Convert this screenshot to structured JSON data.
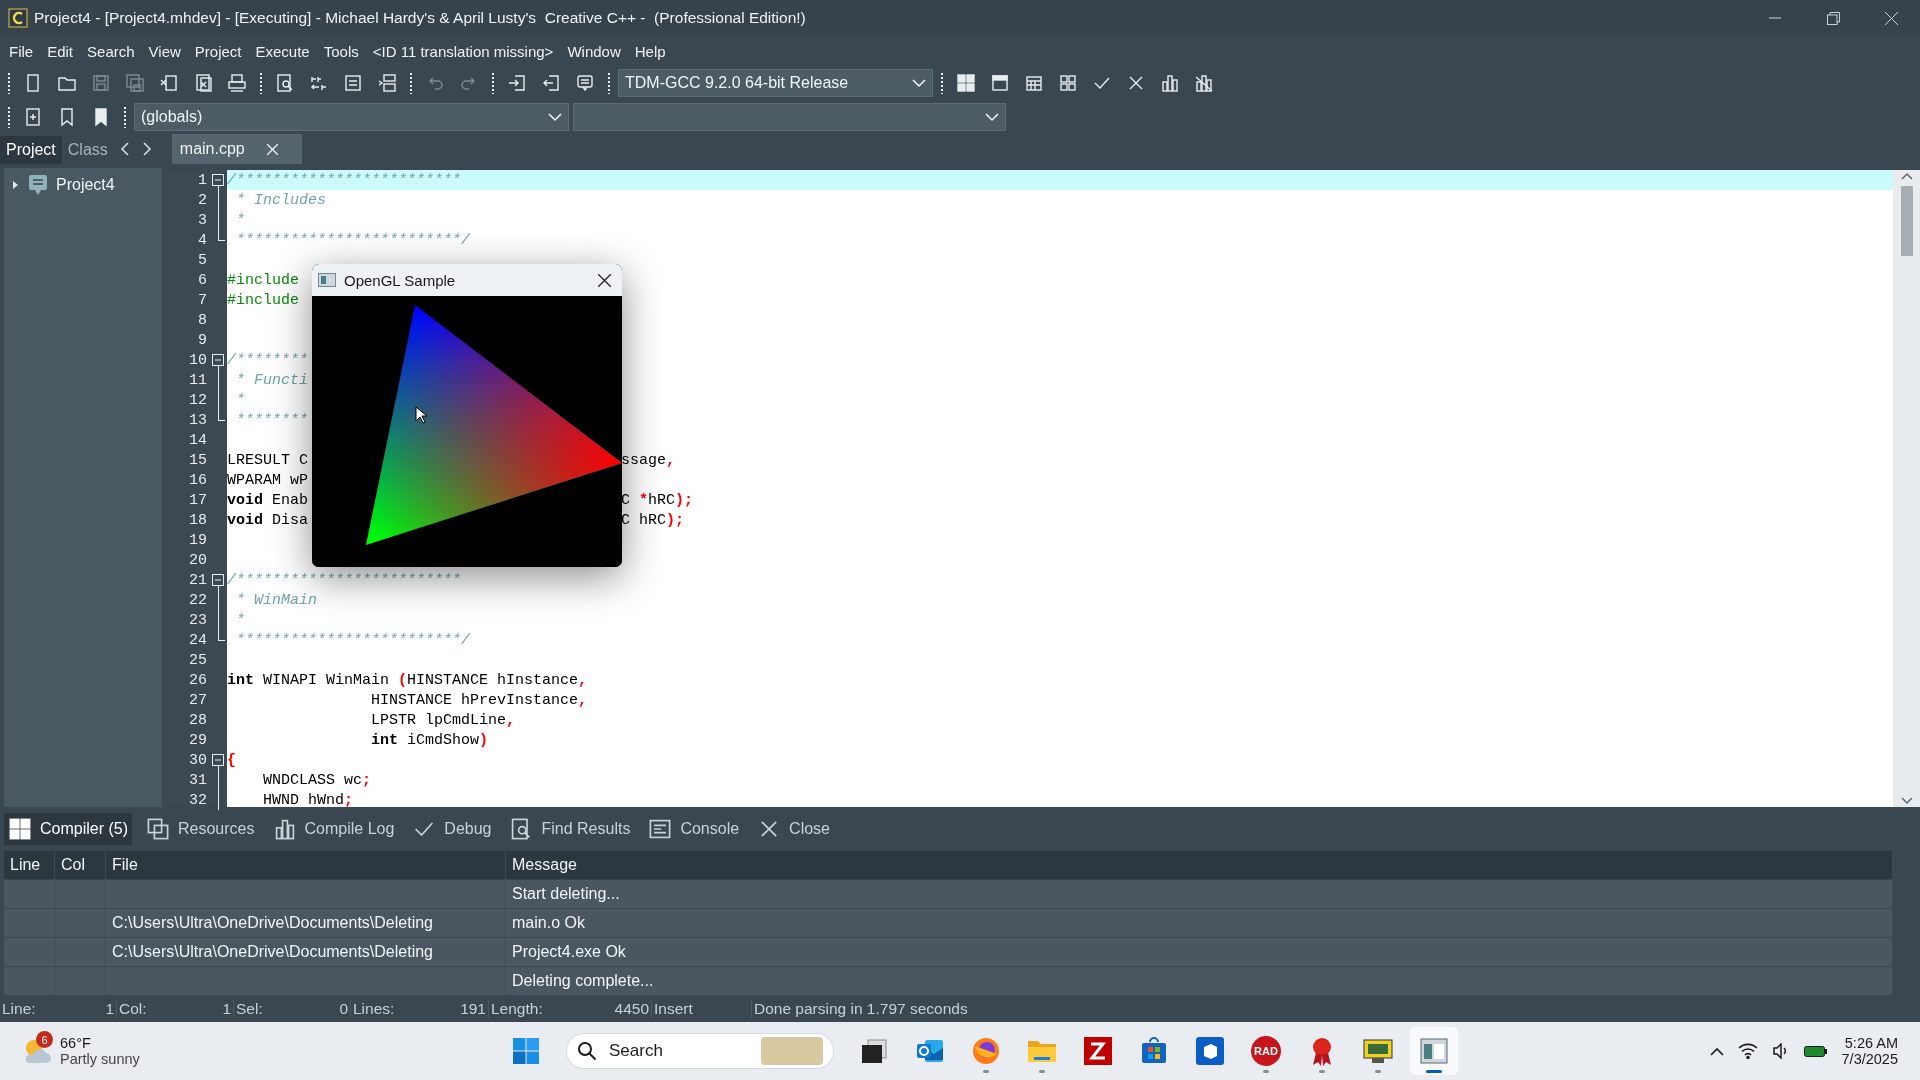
{
  "title_bar": {
    "title": "Project4 - [Project4.mhdev] - [Executing] - Michael Hardy's & April Lusty's  Creative C++ -  (Professional Edition!)"
  },
  "menu": [
    "File",
    "Edit",
    "Search",
    "View",
    "Project",
    "Execute",
    "Tools",
    "<ID 11 translation missing>",
    "Window",
    "Help"
  ],
  "toolbar_1": [
    {
      "kind": "grip",
      "disabled": false
    },
    {
      "kind": "page",
      "disabled": false
    },
    {
      "kind": "folder",
      "disabled": false
    },
    {
      "kind": "floppy",
      "disabled": true
    },
    {
      "kind": "floppies",
      "disabled": true
    },
    {
      "kind": "page-x",
      "disabled": false
    },
    {
      "kind": "pages-x",
      "disabled": false
    },
    {
      "kind": "printer",
      "disabled": false
    },
    {
      "kind": "grip",
      "disabled": false
    },
    {
      "kind": "page-magnifier",
      "disabled": false
    },
    {
      "kind": "spellcheck",
      "disabled": false
    },
    {
      "kind": "indent-box",
      "disabled": false
    },
    {
      "kind": "split-panel",
      "disabled": false
    },
    {
      "kind": "grip",
      "disabled": false
    },
    {
      "kind": "undo",
      "disabled": true
    },
    {
      "kind": "redo",
      "disabled": true
    },
    {
      "kind": "grip",
      "disabled": false
    },
    {
      "kind": "page-arrow-in",
      "disabled": false
    },
    {
      "kind": "page-arrow-out",
      "disabled": false
    },
    {
      "kind": "comment",
      "disabled": false
    },
    {
      "kind": "grip",
      "disabled": false
    },
    {
      "kind": "dropdown",
      "value": "TDM-GCC 9.2.0 64-bit Release",
      "disabled": false
    },
    {
      "kind": "grip",
      "disabled": false
    },
    {
      "kind": "grid",
      "disabled": false
    },
    {
      "kind": "window",
      "disabled": false
    },
    {
      "kind": "calendar",
      "disabled": false
    },
    {
      "kind": "tiles",
      "disabled": false
    },
    {
      "kind": "check",
      "disabled": false
    },
    {
      "kind": "cross",
      "disabled": false
    },
    {
      "kind": "chart",
      "disabled": false
    },
    {
      "kind": "chart-x",
      "disabled": false
    }
  ],
  "toolbar_2": [
    {
      "kind": "grip",
      "disabled": false
    },
    {
      "kind": "page-plus",
      "disabled": false
    },
    {
      "kind": "bookmark",
      "disabled": false
    },
    {
      "kind": "bookmark-filled",
      "disabled": false
    },
    {
      "kind": "grip",
      "disabled": false
    },
    {
      "kind": "dropdown",
      "value": "(globals)",
      "disabled": false
    },
    {
      "kind": "dropdown",
      "disabled": false
    }
  ],
  "side_tabs": [
    {
      "label": "Project",
      "selected": true
    },
    {
      "label": "Class",
      "selected": false
    }
  ],
  "editor_tabs": [
    {
      "label": "main.cpp",
      "selected": true
    }
  ],
  "tree": [
    {
      "label": "Project4",
      "expanded": false
    }
  ],
  "code": [
    {
      "number": "1",
      "kind": "fold-start",
      "current": true,
      "left": [
        {
          "kind": "comment",
          "text": "/*************************"
        }
      ]
    },
    {
      "number": "2",
      "kind": "fold-body",
      "current": false,
      "left": [
        {
          "kind": "comment",
          "text": " * Includes"
        }
      ]
    },
    {
      "number": "3",
      "kind": "fold-body",
      "current": false,
      "left": [
        {
          "kind": "comment",
          "text": " *"
        }
      ]
    },
    {
      "number": "4",
      "kind": "fold-end",
      "current": false,
      "left": [
        {
          "kind": "comment",
          "text": " *************************/"
        }
      ]
    },
    {
      "number": "5",
      "kind": "plain",
      "current": false
    },
    {
      "number": "6",
      "kind": "plain",
      "current": false,
      "left": [
        {
          "kind": "preproc",
          "text": "#include"
        }
      ]
    },
    {
      "number": "7",
      "kind": "plain",
      "current": false,
      "left": [
        {
          "kind": "preproc",
          "text": "#include"
        }
      ]
    },
    {
      "number": "8",
      "kind": "plain",
      "current": false
    },
    {
      "number": "9",
      "kind": "plain",
      "current": false
    },
    {
      "number": "10",
      "kind": "fold-start",
      "current": false,
      "left": [
        {
          "kind": "comment",
          "text": "/********"
        }
      ]
    },
    {
      "number": "11",
      "kind": "fold-body",
      "current": false,
      "left": [
        {
          "kind": "comment",
          "text": " * Functi"
        }
      ]
    },
    {
      "number": "12",
      "kind": "fold-body",
      "current": false,
      "left": [
        {
          "kind": "comment",
          "text": " *"
        }
      ]
    },
    {
      "number": "13",
      "kind": "fold-end",
      "current": false,
      "left": [
        {
          "kind": "comment",
          "text": " ********"
        }
      ]
    },
    {
      "number": "14",
      "kind": "plain",
      "current": false
    },
    {
      "number": "15",
      "kind": "plain",
      "current": false,
      "left": [
        {
          "kind": "plain",
          "text": "LRESULT C"
        }
      ],
      "right": [
        {
          "kind": "plain",
          "text": "ssage"
        },
        {
          "kind": "punct",
          "text": ","
        }
      ]
    },
    {
      "number": "16",
      "kind": "plain",
      "current": false,
      "left": [
        {
          "kind": "plain",
          "text": "WPARAM wP"
        }
      ]
    },
    {
      "number": "17",
      "kind": "plain",
      "current": false,
      "left": [
        {
          "kind": "keyword",
          "text": "void"
        },
        {
          "kind": "plain",
          "text": " Enab"
        }
      ],
      "right": [
        {
          "kind": "plain",
          "text": "C "
        },
        {
          "kind": "punct",
          "text": "*"
        },
        {
          "kind": "plain",
          "text": "hRC"
        },
        {
          "kind": "punct",
          "text": ");"
        }
      ]
    },
    {
      "number": "18",
      "kind": "plain",
      "current": false,
      "left": [
        {
          "kind": "keyword",
          "text": "void"
        },
        {
          "kind": "plain",
          "text": " Disa"
        }
      ],
      "right": [
        {
          "kind": "plain",
          "text": "C hRC"
        },
        {
          "kind": "punct",
          "text": ");"
        }
      ]
    },
    {
      "number": "19",
      "kind": "plain",
      "current": false
    },
    {
      "number": "20",
      "kind": "plain",
      "current": false
    },
    {
      "number": "21",
      "kind": "fold-start",
      "current": false,
      "left": [
        {
          "kind": "comment",
          "text": "/*************************"
        }
      ]
    },
    {
      "number": "22",
      "kind": "fold-body",
      "current": false,
      "left": [
        {
          "kind": "comment",
          "text": " * WinMain"
        }
      ]
    },
    {
      "number": "23",
      "kind": "fold-body",
      "current": false,
      "left": [
        {
          "kind": "comment",
          "text": " *"
        }
      ]
    },
    {
      "number": "24",
      "kind": "fold-end",
      "current": false,
      "left": [
        {
          "kind": "comment",
          "text": " *************************/"
        }
      ]
    },
    {
      "number": "25",
      "kind": "plain",
      "current": false
    },
    {
      "number": "26",
      "kind": "plain",
      "current": false,
      "left": [
        {
          "kind": "keyword",
          "text": "int"
        },
        {
          "kind": "plain",
          "text": " WINAPI WinMain "
        },
        {
          "kind": "punct",
          "text": "("
        },
        {
          "kind": "plain",
          "text": "HINSTANCE hInstance"
        },
        {
          "kind": "punct",
          "text": ","
        }
      ]
    },
    {
      "number": "27",
      "kind": "plain",
      "current": false,
      "left": [
        {
          "kind": "plain",
          "text": "                HINSTANCE hPrevInstance"
        },
        {
          "kind": "punct",
          "text": ","
        }
      ]
    },
    {
      "number": "28",
      "kind": "plain",
      "current": false,
      "left": [
        {
          "kind": "plain",
          "text": "                LPSTR lpCmdLine"
        },
        {
          "kind": "punct",
          "text": ","
        }
      ]
    },
    {
      "number": "29",
      "kind": "plain",
      "current": false,
      "left": [
        {
          "kind": "keyword",
          "text": "                int"
        },
        {
          "kind": "plain",
          "text": " iCmdShow"
        },
        {
          "kind": "punct",
          "text": ")"
        }
      ]
    },
    {
      "number": "30",
      "kind": "fold-start",
      "current": false,
      "left": [
        {
          "kind": "punct",
          "text": "{"
        }
      ]
    },
    {
      "number": "31",
      "kind": "fold-body",
      "current": false,
      "left": [
        {
          "kind": "plain",
          "text": "    WNDCLASS wc"
        },
        {
          "kind": "punct",
          "text": ";"
        }
      ]
    },
    {
      "number": "32",
      "kind": "fold-body",
      "current": false,
      "left": [
        {
          "kind": "plain",
          "text": "    HWND hWnd"
        },
        {
          "kind": "punct",
          "text": ";"
        }
      ]
    }
  ],
  "opengl_window": {
    "title": "OpenGL Sample"
  },
  "bottom_tabs": [
    {
      "kind": "grid",
      "label": "Compiler (5)",
      "selected": true
    },
    {
      "kind": "copy",
      "label": "Resources",
      "selected": false
    },
    {
      "kind": "chart",
      "label": "Compile Log",
      "selected": false
    },
    {
      "kind": "check",
      "label": "Debug",
      "selected": false
    },
    {
      "kind": "page-magnifier",
      "label": "Find Results",
      "selected": false
    },
    {
      "kind": "console",
      "label": "Console",
      "selected": false
    },
    {
      "kind": "cross",
      "label": "Close",
      "selected": false
    }
  ],
  "table": {
    "columns": [
      "Line",
      "Col",
      "File",
      "Message"
    ],
    "rows": [
      {
        "message": "Start deleting..."
      },
      {
        "file": "C:\\Users\\Ultra\\OneDrive\\Documents\\Deleting",
        "message": "main.o Ok"
      },
      {
        "file": "C:\\Users\\Ultra\\OneDrive\\Documents\\Deleting",
        "message": "Project4.exe Ok"
      },
      {
        "message": "Deleting complete..."
      }
    ]
  },
  "status_bar": [
    {
      "label": "Line:",
      "value": "1"
    },
    {
      "label": "Col:",
      "value": "1"
    },
    {
      "label": "Sel:",
      "value": "0"
    },
    {
      "label": "Lines:",
      "value": "191"
    },
    {
      "label": "Length:",
      "value": "4450"
    },
    {
      "label": "Insert"
    },
    {
      "label": "Done parsing in 1.797 seconds"
    }
  ],
  "taskbar": {
    "weather": {
      "badge": "6",
      "temperature": "66°F",
      "condition": "Partly sunny"
    },
    "apps": [
      {
        "kind": "start",
        "running": false,
        "selected": false
      },
      {
        "kind": "window-square",
        "running": false,
        "selected": false
      },
      {
        "kind": "mail",
        "running": false,
        "selected": false
      },
      {
        "kind": "browser",
        "running": true,
        "selected": false
      },
      {
        "kind": "folder",
        "running": true,
        "selected": false
      },
      {
        "kind": "zigzag",
        "running": false,
        "selected": false
      },
      {
        "kind": "store",
        "running": false,
        "selected": false
      },
      {
        "kind": "box",
        "running": false,
        "selected": false
      },
      {
        "kind": "rad",
        "label": "RAD",
        "running": true,
        "selected": false
      },
      {
        "kind": "ribbon",
        "running": true,
        "selected": false
      },
      {
        "kind": "monitor",
        "running": true,
        "selected": false
      },
      {
        "kind": "window",
        "running": true,
        "selected": true
      }
    ],
    "search": {
      "placeholder": "Search"
    },
    "time": "5:26 AM",
    "date": "7/3/2025"
  }
}
